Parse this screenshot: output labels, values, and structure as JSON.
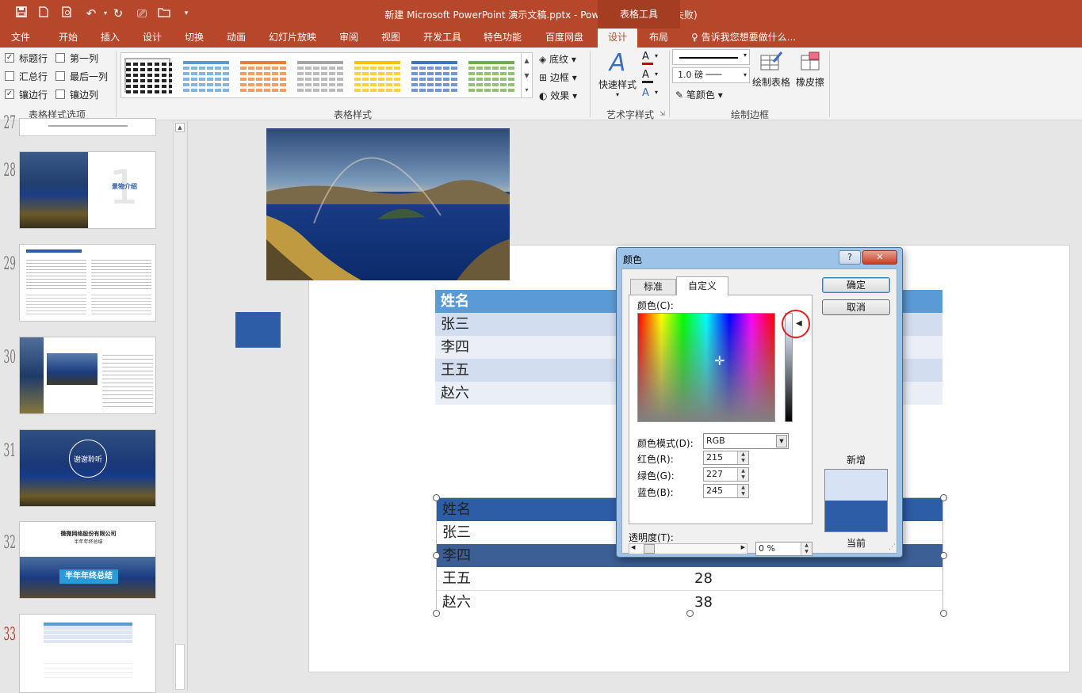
{
  "app": {
    "title": "新建 Microsoft PowerPoint 演示文稿.pptx - PowerPoint(产品激活失败)",
    "context_tab": "表格工具"
  },
  "tabs": [
    "文件",
    "开始",
    "插入",
    "设计",
    "切换",
    "动画",
    "幻灯片放映",
    "审阅",
    "视图",
    "开发工具",
    "特色功能",
    "百度网盘",
    "设计",
    "布局"
  ],
  "tell_me": "告诉我您想要做什么...",
  "ribbon": {
    "style_options": {
      "items": [
        {
          "label": "标题行",
          "checked": true
        },
        {
          "label": "第一列",
          "checked": false
        },
        {
          "label": "汇总行",
          "checked": false
        },
        {
          "label": "最后一列",
          "checked": false
        },
        {
          "label": "镶边行",
          "checked": true
        },
        {
          "label": "镶边列",
          "checked": false
        }
      ],
      "group_label": "表格样式选项"
    },
    "table_styles": {
      "group_label": "表格样式",
      "swatch_colors": [
        "#ffffff",
        "#5b9bd5",
        "#ed7d31",
        "#a5a5a5",
        "#ffc000",
        "#4472c4",
        "#70ad47"
      ],
      "shading": "底纹",
      "borders": "边框",
      "effects": "效果"
    },
    "wordart": {
      "quick_styles": "快速样式",
      "group_label": "艺术字样式"
    },
    "draw_borders": {
      "pen_weight": "1.0 磅",
      "pen_color": "笔颜色",
      "draw_table": "绘制表格",
      "eraser": "橡皮擦",
      "group_label": "绘制边框"
    }
  },
  "slides": {
    "numbers": [
      "27",
      "28",
      "29",
      "30",
      "31",
      "32",
      "33"
    ],
    "thumb28_title": "景物介绍",
    "thumb28_number": "1",
    "thumb31_text": "谢谢聆听",
    "thumb32_company": "微微网络股份有限公司",
    "thumb32_title": "半年年终总结",
    "thumb32_banner": "半年年终总结"
  },
  "table_top": {
    "rows": [
      "姓名",
      "张三",
      "李四",
      "王五",
      "赵六"
    ]
  },
  "table_bottom": {
    "rows": [
      {
        "name": "姓名",
        "value": ""
      },
      {
        "name": "张三",
        "value": ""
      },
      {
        "name": "李四",
        "value": ""
      },
      {
        "name": "王五",
        "value": "28"
      },
      {
        "name": "赵六",
        "value": "38"
      }
    ]
  },
  "dialog": {
    "title": "颜色",
    "help": "?",
    "close": "✕",
    "tab_standard": "标准",
    "tab_custom": "自定义",
    "colors_label": "颜色(C):",
    "color_model_label": "颜色模式(D):",
    "color_model_value": "RGB",
    "red_label": "红色(R):",
    "red_value": "215",
    "green_label": "绿色(G):",
    "green_value": "227",
    "blue_label": "蓝色(B):",
    "blue_value": "245",
    "transparency_label": "透明度(T):",
    "transparency_value": "0 %",
    "ok": "确定",
    "cancel": "取消",
    "new_label": "新增",
    "current_label": "当前",
    "new_color": "#d7e3f5",
    "current_color": "#2e5da8"
  }
}
